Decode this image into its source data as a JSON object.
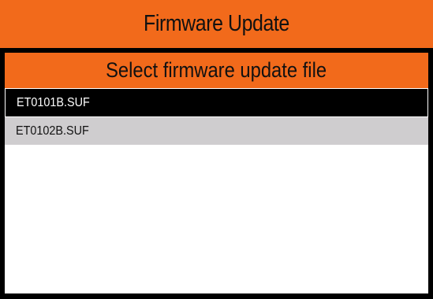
{
  "app": {
    "title": "Firmware Update"
  },
  "dialog": {
    "header": "Select firmware update file",
    "files": [
      {
        "name": "ET0101B.SUF",
        "selected": true
      },
      {
        "name": "ET0102B.SUF",
        "selected": false
      }
    ]
  },
  "colors": {
    "accent": "#f26a1b",
    "screen_background": "#000000",
    "panel_background": "#ffffff",
    "selected_row": "#000000",
    "unselected_row": "#cfcdcf"
  }
}
